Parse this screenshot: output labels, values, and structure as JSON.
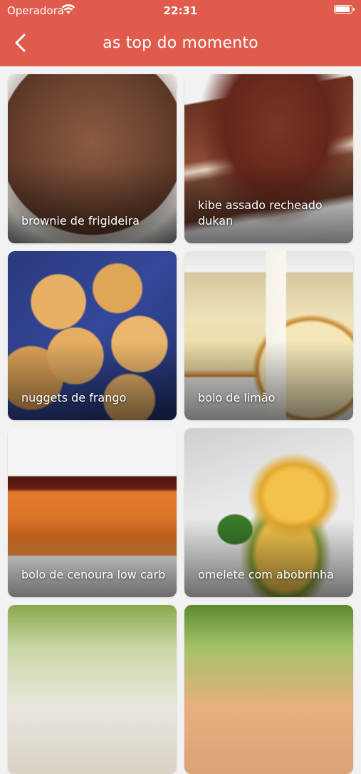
{
  "status_bar": {
    "carrier": "Operadora",
    "time": "22:31",
    "battery_level": 0.95
  },
  "header": {
    "title": "as top do momento",
    "color": "#e05b4c"
  },
  "recipes": [
    {
      "label": "brownie de frigideira"
    },
    {
      "label": "kibe assado recheado dukan"
    },
    {
      "label": "nuggets de frango"
    },
    {
      "label": "bolo de limão"
    },
    {
      "label": "bolo de cenoura low carb"
    },
    {
      "label": "omelete com abobrinha"
    },
    {
      "label": ""
    },
    {
      "label": ""
    }
  ]
}
